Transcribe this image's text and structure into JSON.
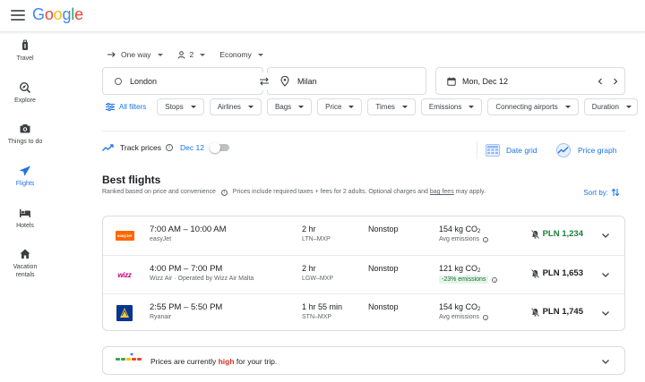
{
  "header": {
    "logo": {
      "G": "G",
      "o1": "o",
      "o2": "o",
      "g": "g",
      "l": "l",
      "e": "e"
    }
  },
  "sidebar": {
    "items": [
      {
        "label": "Travel",
        "icon": "luggage-icon"
      },
      {
        "label": "Explore",
        "icon": "explore-icon"
      },
      {
        "label": "Things to do",
        "icon": "camera-icon"
      },
      {
        "label": "Flights",
        "icon": "airplane-icon",
        "active": true
      },
      {
        "label": "Hotels",
        "icon": "bed-icon"
      },
      {
        "label": "Vacation rentals",
        "icon": "house-icon"
      }
    ]
  },
  "search": {
    "trip_type": "One way",
    "passengers": "2",
    "cabin_class": "Economy",
    "origin": "London",
    "destination": "Milan",
    "date": "Mon, Dec 12"
  },
  "filters": {
    "all_filters": "All filters",
    "chips": [
      "Stops",
      "Airlines",
      "Bags",
      "Price",
      "Times",
      "Emissions",
      "Connecting airports",
      "Duration"
    ]
  },
  "tracking": {
    "label": "Track prices",
    "date": "Dec 12",
    "date_grid": "Date grid",
    "price_graph": "Price graph"
  },
  "results": {
    "heading": "Best flights",
    "subtext_a": "Ranked based on price and convenience",
    "subtext_b": "Prices include required taxes + fees for 2 adults. Optional charges and",
    "subtext_link": "bag fees",
    "subtext_c": "may apply.",
    "sort_label": "Sort by:",
    "flights": [
      {
        "times": "7:00 AM – 10:00 AM",
        "airline": "easyJet",
        "duration": "2 hr",
        "route": "LTN–MXP",
        "stops": "Nonstop",
        "co2": "154 kg CO",
        "emissions": "Avg emissions",
        "emissions_is_badge": false,
        "price": "PLN 1,234",
        "price_low": true,
        "logo": "easyjet-logo"
      },
      {
        "times": "4:00 PM – 7:00 PM",
        "airline": "Wizz Air · Operated by Wizz Air Malta",
        "duration": "2 hr",
        "route": "LGW–MXP",
        "stops": "Nonstop",
        "co2": "121 kg CO",
        "emissions": "-23% emissions",
        "emissions_is_badge": true,
        "price": "PLN 1,653",
        "price_low": false,
        "logo": "wizzair-logo"
      },
      {
        "times": "2:55 PM – 5:50 PM",
        "airline": "Ryanair",
        "duration": "1 hr 55 min",
        "route": "STN–MXP",
        "stops": "Nonstop",
        "co2": "154 kg CO",
        "emissions": "Avg emissions",
        "emissions_is_badge": false,
        "price": "PLN 1,745",
        "price_low": false,
        "logo": "ryanair-logo"
      }
    ],
    "co2_subscript": "2"
  },
  "insight": {
    "prefix": "Prices are currently",
    "level": "high",
    "suffix": "for your trip."
  },
  "colors": {
    "accent": "#1a73e8",
    "low_price": "#188038",
    "high": "#d93025"
  }
}
